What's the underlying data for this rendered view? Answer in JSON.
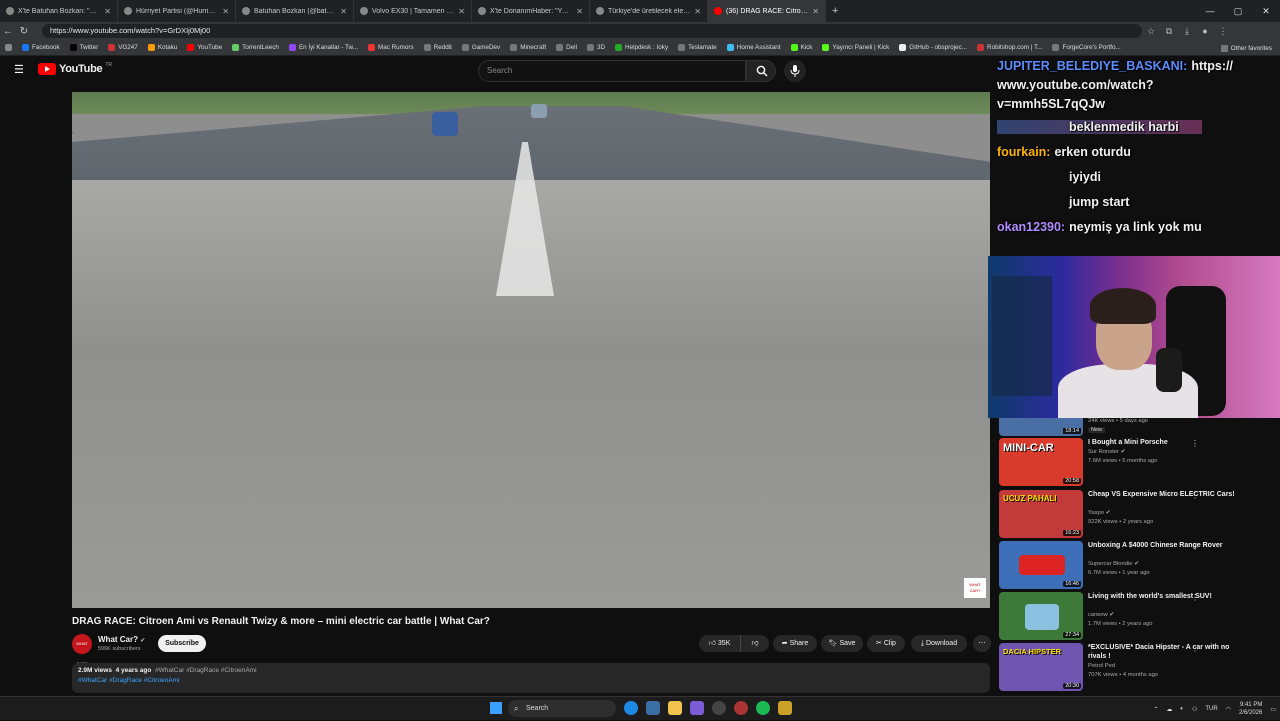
{
  "browser": {
    "tabs": [
      {
        "title": "X'te Batuhan Bozkan: \"Paypal, App...",
        "active": false
      },
      {
        "title": "Hürriyet Partisi (@HurriyetPartiTr)",
        "active": false
      },
      {
        "title": "Batuhan Bozkan (@batubozkan) / X",
        "active": false
      },
      {
        "title": "Volvo EX30 | Tamamen elektrikli k...",
        "active": false
      },
      {
        "title": "X'te DonanımHaber: \"Yurtdışı...",
        "active": false
      },
      {
        "title": "Türkiye'de üretilecek elektrikli Hy...",
        "active": false
      },
      {
        "title": "(36) DRAG RACE: Citroen Ami...",
        "active": true
      }
    ],
    "url": "https://www.youtube.com/watch?v=GrDXIj0Mj00",
    "bookmarks": [
      "Facebook",
      "Twitter",
      "VG247",
      "Kotaku",
      "YouTube",
      "TorrentLeech",
      "En İyi Kanallar - Tw...",
      "Mac Rumors",
      "Reddit",
      "GameDev",
      "Minecraft",
      "Dell",
      "3D",
      "Helpdesk : Ioky",
      "Teslamate",
      "Home Assistant",
      "Kick",
      "Yayıncı Paneli | Kick",
      "GitHub - obsprojec...",
      "Robitshop.com | T...",
      "ForgeCore's Portfo..."
    ],
    "other_favorites": "Other favorites"
  },
  "youtube": {
    "logo_text": "YouTube",
    "logo_country": "TR",
    "search_placeholder": "Search",
    "video": {
      "title": "DRAG RACE: Citroen Ami vs Renault Twizy & more – mini electric car battle | What Car?",
      "watermark": "WHAT CAR?",
      "channel": "What Car?",
      "channel_avatar": "WHAT CAR?",
      "subscribers": "596K subscribers",
      "subscribe_label": "Subscribe",
      "likes": "35K",
      "share_label": "Share",
      "save_label": "Save",
      "clip_label": "Clip",
      "download_label": "Download",
      "views": "2.9M views",
      "age": "4 years ago",
      "hashtags_top": "#WhatCar #DragRace #CitroenAmi",
      "hashtags_bottom": "#WhatCar #DragRace #CitroenAmi"
    },
    "recommendations": [
      {
        "title": "I Bought a Mini Porsche",
        "channel": "Sur Ronster",
        "meta": "7.6M views • 5 months ago",
        "duration": "20:58",
        "thumb_text": "MINI-CAR",
        "thumb_color": "#d83a2c"
      },
      {
        "title": "Cheap VS Expensive Micro ELECTRIC Cars!",
        "channel": "Yaspo",
        "meta": "922K views • 2 years ago",
        "duration": "16:23",
        "thumb_text": "UCUZ PAHALI",
        "thumb_color": "#c33a3a"
      },
      {
        "title": "Unboxing A $4000 Chinese Range Rover",
        "channel": "Supercar Blondie",
        "meta": "6.7M views • 1 year ago",
        "duration": "16:46",
        "thumb_text": "",
        "thumb_color": "#3c6fb8"
      },
      {
        "title": "Living with the world's smallest SUV!",
        "channel": "carwow",
        "meta": "1.7M views • 2 years ago",
        "duration": "27:34",
        "thumb_text": "",
        "thumb_color": "#3d7a3a"
      },
      {
        "title": "*EXCLUSIVE* Dacia Hipster - A car with no rivals !",
        "channel": "Petrol Ped",
        "meta": "707K views • 4 months ago",
        "duration": "20:30",
        "thumb_text": "DACIA HIPSTER",
        "thumb_color": "#6d55b0"
      }
    ],
    "partial_rec": {
      "meta": "24K views • 5 days ago",
      "badge": "New",
      "duration": "18:14"
    }
  },
  "chat": [
    {
      "name": "JUPITER_BELEDIYE_BASKANI:",
      "message": "https://",
      "name_color": "#5b8cff"
    },
    {
      "name": "",
      "message": "www.youtube.com/watch?",
      "name_color": "#ffffff"
    },
    {
      "name": "",
      "message": "v=mmh5SL7qQJw",
      "name_color": "#ffffff"
    },
    {
      "name": "",
      "message": "beklenmedik harbi",
      "name_color": "#b28cff"
    },
    {
      "name": "fourkain:",
      "message": "erken oturdu",
      "name_color": "#ffb300"
    },
    {
      "name": "",
      "message": "iyiydi",
      "name_color": "#6fa8ff"
    },
    {
      "name": "",
      "message": "jump start",
      "name_color": "#ff4d4d"
    },
    {
      "name": "okan12390:",
      "message": "neymiş ya link yok mu",
      "name_color": "#b28cff"
    }
  ],
  "taskbar": {
    "search_label": "Search",
    "language": "TUR",
    "time": "9:41 PM",
    "date": "2/6/2026"
  }
}
